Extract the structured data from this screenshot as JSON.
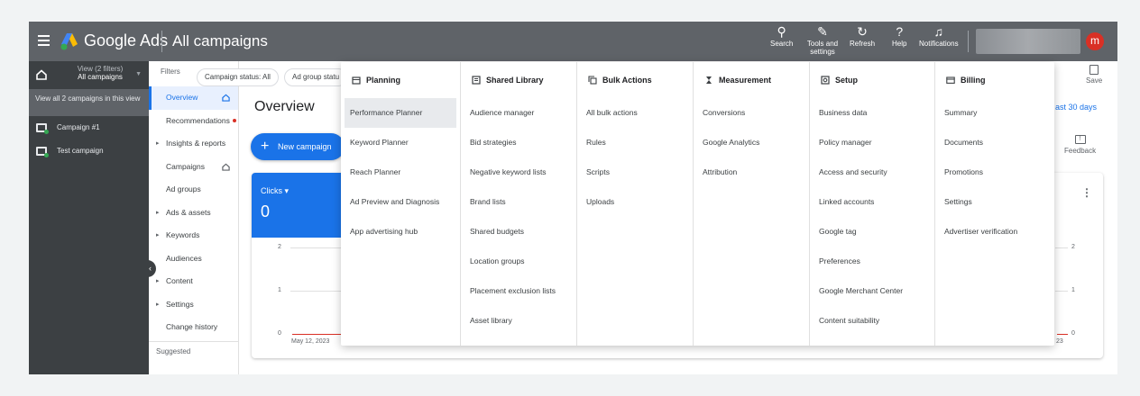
{
  "topbar": {
    "brand": "Google Ads",
    "page_title": "All campaigns",
    "buttons": [
      {
        "label": "Search",
        "icon": "search-icon"
      },
      {
        "label": "Tools and settings",
        "icon": "wrench-icon"
      },
      {
        "label": "Refresh",
        "icon": "refresh-icon"
      },
      {
        "label": "Help",
        "icon": "help-icon"
      },
      {
        "label": "Notifications",
        "icon": "bell-icon"
      }
    ],
    "avatar_letter": "m"
  },
  "left_panel": {
    "view_label": "View (2 filters)",
    "view_sub": "All campaigns",
    "view_all": "View all 2 campaigns in this view",
    "campaigns": [
      "Campaign #1",
      "Test campaign"
    ]
  },
  "nav": {
    "items": [
      {
        "label": "Overview"
      },
      {
        "label": "Recommendations"
      },
      {
        "label": "Insights & reports"
      },
      {
        "label": "Campaigns"
      },
      {
        "label": "Ad groups"
      },
      {
        "label": "Ads & assets"
      },
      {
        "label": "Keywords"
      },
      {
        "label": "Audiences"
      },
      {
        "label": "Content"
      },
      {
        "label": "Settings"
      },
      {
        "label": "Change history"
      }
    ],
    "suggested": "Suggested"
  },
  "filters": {
    "label": "Filters",
    "chips": [
      "Campaign status: All",
      "Ad group statu"
    ]
  },
  "main": {
    "title": "Overview",
    "date_range": "ast 30 days",
    "save_label": "Save",
    "feedback_label": "Feedback",
    "new_campaign": "New campaign",
    "metric_label": "Clicks",
    "metric_value": "0",
    "y_ticks": [
      "2",
      "1",
      "0"
    ],
    "x_start": "May 12, 2023",
    "x_end": "23"
  },
  "menu": {
    "columns": [
      {
        "title": "Planning",
        "icon": "calendar-icon",
        "items": [
          "Performance Planner",
          "Keyword Planner",
          "Reach Planner",
          "Ad Preview and Diagnosis",
          "App advertising hub"
        ]
      },
      {
        "title": "Shared Library",
        "icon": "library-icon",
        "items": [
          "Audience manager",
          "Bid strategies",
          "Negative keyword lists",
          "Brand lists",
          "Shared budgets",
          "Location groups",
          "Placement exclusion lists",
          "Asset library"
        ]
      },
      {
        "title": "Bulk Actions",
        "icon": "copy-icon",
        "items": [
          "All bulk actions",
          "Rules",
          "Scripts",
          "Uploads"
        ]
      },
      {
        "title": "Measurement",
        "icon": "hourglass-icon",
        "items": [
          "Conversions",
          "Google Analytics",
          "Attribution"
        ]
      },
      {
        "title": "Setup",
        "icon": "setup-icon",
        "items": [
          "Business data",
          "Policy manager",
          "Access and security",
          "Linked accounts",
          "Google tag",
          "Preferences",
          "Google Merchant Center",
          "Content suitability"
        ]
      },
      {
        "title": "Billing",
        "icon": "credit-card-icon",
        "items": [
          "Summary",
          "Documents",
          "Promotions",
          "Settings",
          "Advertiser verification"
        ]
      }
    ],
    "selected": "Performance Planner"
  },
  "colors": {
    "topbar": "#5f6368",
    "accent": "#1a73e8",
    "left_panel": "#3c4043",
    "avatar": "#d93025"
  }
}
